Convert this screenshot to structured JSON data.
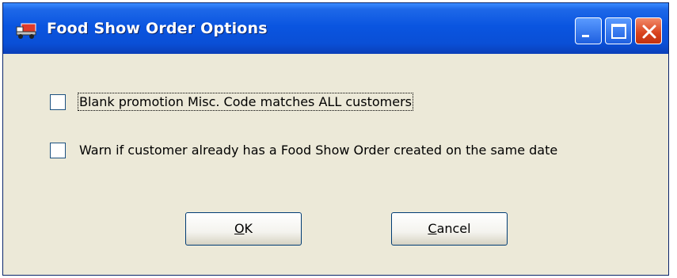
{
  "window": {
    "title": "Food Show Order Options",
    "icon": "truck-icon"
  },
  "titlebar_buttons": {
    "minimize_icon": "minimize-icon",
    "maximize_icon": "maximize-icon",
    "close_icon": "close-icon"
  },
  "options": [
    {
      "label": "Blank promotion Misc. Code matches ALL  customers",
      "checked": false
    },
    {
      "label": "Warn if customer already has a Food Show Order created on the same date",
      "checked": false
    }
  ],
  "buttons": {
    "ok": {
      "accel": "O",
      "rest": "K"
    },
    "cancel": {
      "accel": "C",
      "rest": "ancel"
    }
  },
  "colors": {
    "titlebar": "#0a55e0",
    "dialog_bg": "#ece9d8",
    "close_button": "#d8421c"
  }
}
